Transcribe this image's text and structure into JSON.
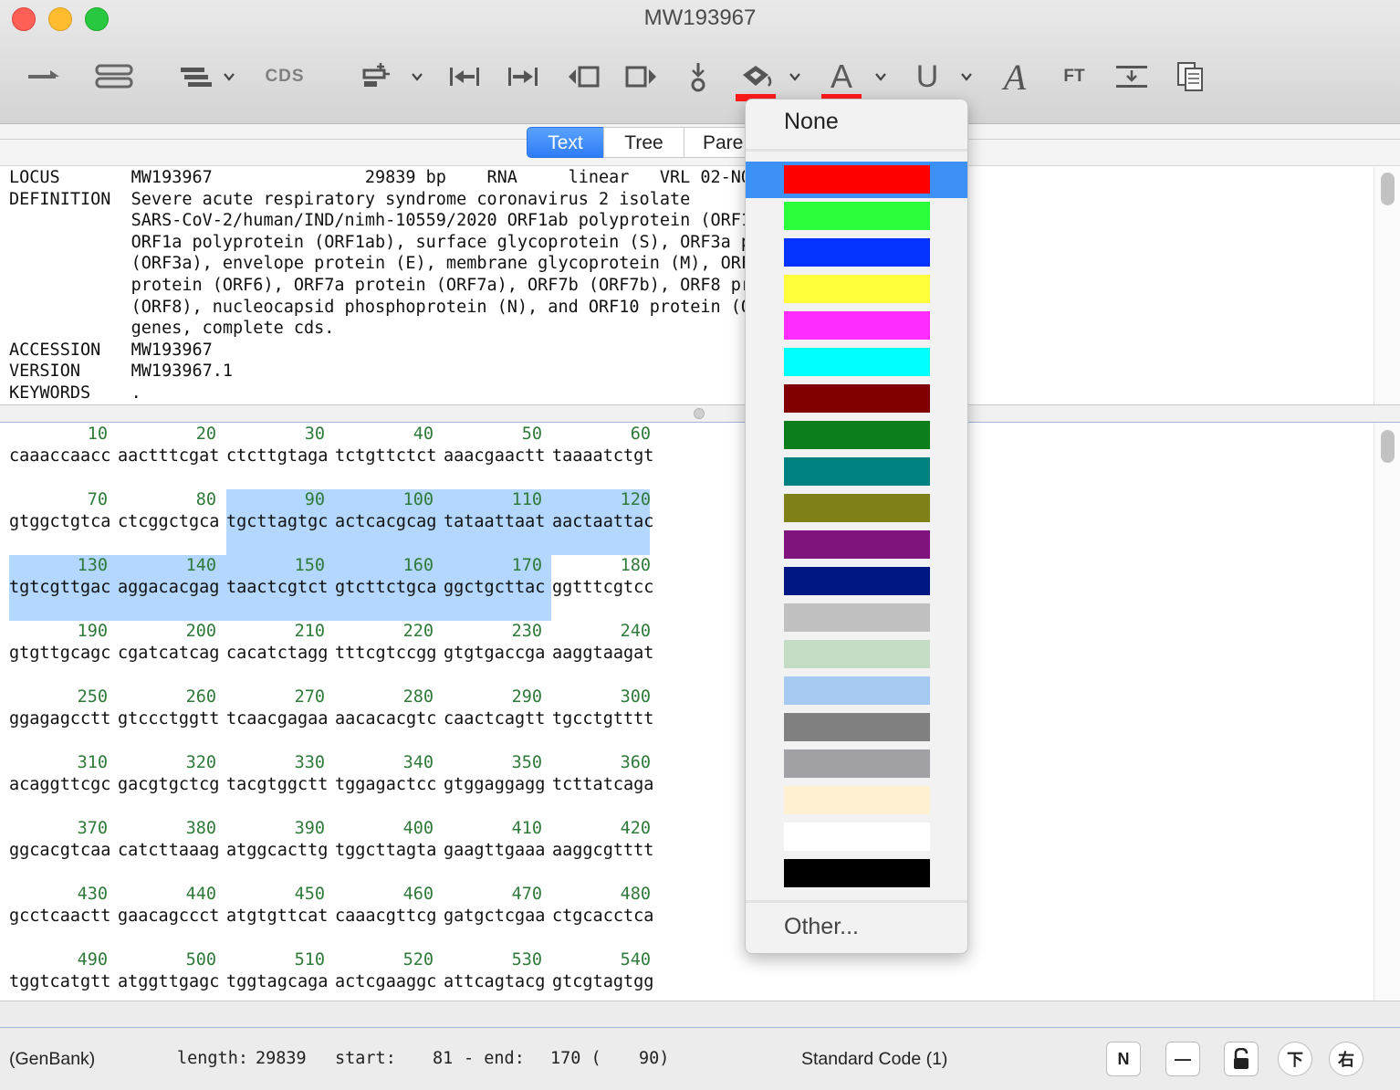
{
  "window": {
    "title": "MW193967"
  },
  "toolbar": {
    "cds_label": "CDS",
    "ft_label": "FT",
    "highlight_color": "#ff1a1a",
    "text_color": "#ff1a1a",
    "icons": [
      "feature-arrow-icon",
      "feature-box-icon",
      "feature-list-icon",
      "cds-icon",
      "insert-feature-icon",
      "go-start-icon",
      "go-end-icon",
      "select-left-icon",
      "select-right-icon",
      "cursor-position-icon",
      "highlight-icon",
      "text-color-icon",
      "underline-icon",
      "italic-font-icon",
      "ft-icon",
      "align-icon",
      "copy-icon"
    ]
  },
  "tabs": [
    "Text",
    "Tree",
    "Pare"
  ],
  "header": {
    "lines": [
      "LOCUS       MW193967               29839 bp    RNA     linear   VRL 02-NOV-",
      "DEFINITION  Severe acute respiratory syndrome coronavirus 2 isolate",
      "            SARS-CoV-2/human/IND/nimh-10559/2020 ORF1ab polyprotein (ORF1ab",
      "            ORF1a polyprotein (ORF1ab), surface glycoprotein (S), ORF3a pro",
      "            (ORF3a), envelope protein (E), membrane glycoprotein (M), ORF6",
      "            protein (ORF6), ORF7a protein (ORF7a), ORF7b (ORF7b), ORF8 prot",
      "            (ORF8), nucleocapsid phosphoprotein (N), and ORF10 protein (ORF",
      "            genes, complete cds.",
      "ACCESSION   MW193967",
      "VERSION     MW193967.1",
      "KEYWORDS    ."
    ]
  },
  "sequence": {
    "rows": [
      {
        "numbers": [
          "10",
          "20",
          "30",
          "40",
          "50",
          "60"
        ],
        "bases": [
          "caaaccaacc",
          "aactttcgat",
          "ctcttgtaga",
          "tctgttctct",
          "aaacgaactt",
          "taaaatctgt"
        ]
      },
      {
        "numbers": [
          "70",
          "80",
          "90",
          "100",
          "110",
          "120"
        ],
        "bases": [
          "gtggctgtca",
          "ctcggctgca",
          "tgcttagtgc",
          "actcacgcag",
          "tataattaat",
          "aactaattac"
        ]
      },
      {
        "numbers": [
          "130",
          "140",
          "150",
          "160",
          "170",
          "180"
        ],
        "bases": [
          "tgtcgttgac",
          "aggacacgag",
          "taactcgtct",
          "gtcttctgca",
          "ggctgcttac",
          "ggtttcgtcc"
        ]
      },
      {
        "numbers": [
          "190",
          "200",
          "210",
          "220",
          "230",
          "240"
        ],
        "bases": [
          "gtgttgcagc",
          "cgatcatcag",
          "cacatctagg",
          "tttcgtccgg",
          "gtgtgaccga",
          "aaggtaagat"
        ]
      },
      {
        "numbers": [
          "250",
          "260",
          "270",
          "280",
          "290",
          "300"
        ],
        "bases": [
          "ggagagcctt",
          "gtccctggtt",
          "tcaacgagaa",
          "aacacacgtc",
          "caactcagtt",
          "tgcctgtttt"
        ]
      },
      {
        "numbers": [
          "310",
          "320",
          "330",
          "340",
          "350",
          "360"
        ],
        "bases": [
          "acaggttcgc",
          "gacgtgctcg",
          "tacgtggctt",
          "tggagactcc",
          "gtggaggagg",
          "tcttatcaga"
        ]
      },
      {
        "numbers": [
          "370",
          "380",
          "390",
          "400",
          "410",
          "420"
        ],
        "bases": [
          "ggcacgtcaa",
          "catcttaaag",
          "atggcacttg",
          "tggcttagta",
          "gaagttgaaa",
          "aaggcgtttt"
        ]
      },
      {
        "numbers": [
          "430",
          "440",
          "450",
          "460",
          "470",
          "480"
        ],
        "bases": [
          "gcctcaactt",
          "gaacagccct",
          "atgtgttcat",
          "caaacgttcg",
          "gatgctcgaa",
          "ctgcacctca"
        ]
      },
      {
        "numbers": [
          "490",
          "500",
          "510",
          "520",
          "530",
          "540"
        ],
        "bases": [
          "tggtcatgtt",
          "atggttgagc",
          "tggtagcaga",
          "actcgaaggc",
          "attcagtacg",
          "gtcgtagtgg"
        ]
      }
    ],
    "selection": {
      "start": 81,
      "end": 170
    }
  },
  "status": {
    "format": "(GenBank)",
    "length_label": "length:",
    "length_value": "29839",
    "start_label": "start:",
    "start_value": "81",
    "end_label": "- end:",
    "end_value": "170 (",
    "span_value": "90)",
    "genetic_code": "Standard Code (1)",
    "buttons": [
      "N",
      "—",
      "⊡",
      "下",
      "右"
    ]
  },
  "color_menu": {
    "none_label": "None",
    "other_label": "Other...",
    "highlight_bg": "#3d91f6",
    "swatches": [
      "#ff0000",
      "#2bff3b",
      "#0433ff",
      "#ffff3b",
      "#ff2cff",
      "#00ffff",
      "#800000",
      "#0c7f1c",
      "#008080",
      "#808018",
      "#80137e",
      "#001682",
      "#c0c0c0",
      "#c3dcc3",
      "#a5c9f0",
      "#808080",
      "#a0a0a5",
      "#fff0d2",
      "#ffffff",
      "#000000"
    ],
    "selected_index": 0
  }
}
